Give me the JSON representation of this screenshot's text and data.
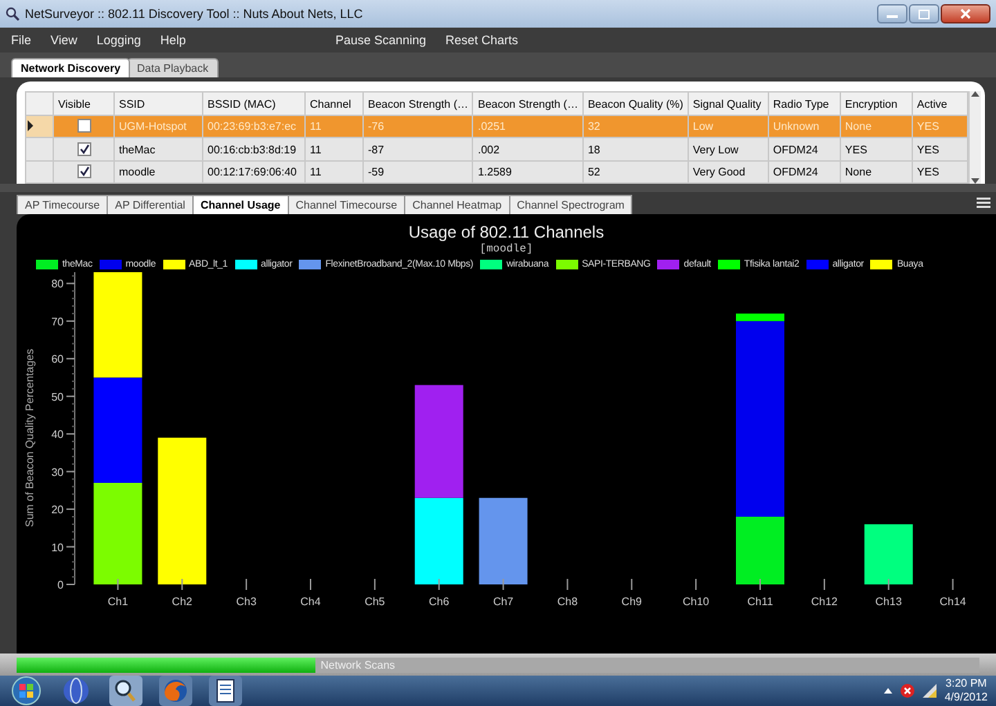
{
  "window": {
    "title": "NetSurveyor :: 802.11 Discovery Tool :: Nuts About Nets, LLC"
  },
  "menu": [
    "File",
    "View",
    "Logging",
    "Help"
  ],
  "toolbar": [
    "Pause Scanning",
    "Reset Charts"
  ],
  "tabs": [
    {
      "label": "Network Discovery",
      "selected": true
    },
    {
      "label": "Data Playback",
      "selected": false
    }
  ],
  "table": {
    "columns": [
      "Visible",
      "SSID",
      "BSSID (MAC)",
      "Channel",
      "Beacon Strength (…",
      "Beacon Strength (…",
      "Beacon Quality (%)",
      "Signal Quality",
      "Radio Type",
      "Encryption",
      "Active"
    ],
    "rows": [
      {
        "selected": true,
        "cells": [
          {
            "kind": "checkbox",
            "checked": false
          },
          {
            "kind": "text",
            "text": "UGM-Hotspot"
          },
          {
            "kind": "text",
            "text": "00:23:69:b3:e7:ec"
          },
          {
            "kind": "text",
            "text": "11"
          },
          {
            "kind": "text",
            "text": "-76"
          },
          {
            "kind": "text",
            "text": ".0251"
          },
          {
            "kind": "text",
            "text": "32"
          },
          {
            "kind": "text",
            "text": "Low"
          },
          {
            "kind": "text",
            "text": "Unknown"
          },
          {
            "kind": "text",
            "text": "None"
          },
          {
            "kind": "text",
            "text": "YES"
          }
        ]
      },
      {
        "selected": false,
        "cells": [
          {
            "kind": "checkbox",
            "checked": true
          },
          {
            "kind": "text",
            "text": "theMac"
          },
          {
            "kind": "text",
            "text": "00:16:cb:b3:8d:19"
          },
          {
            "kind": "text",
            "text": "11"
          },
          {
            "kind": "text",
            "text": "-87"
          },
          {
            "kind": "text",
            "text": ".002"
          },
          {
            "kind": "text",
            "text": "18"
          },
          {
            "kind": "text",
            "text": "Very Low"
          },
          {
            "kind": "text",
            "text": "OFDM24"
          },
          {
            "kind": "text",
            "text": "YES"
          },
          {
            "kind": "text",
            "text": "YES"
          }
        ]
      },
      {
        "selected": false,
        "cells": [
          {
            "kind": "checkbox",
            "checked": true
          },
          {
            "kind": "text",
            "text": "moodle"
          },
          {
            "kind": "text",
            "text": "00:12:17:69:06:40"
          },
          {
            "kind": "text",
            "text": "11"
          },
          {
            "kind": "text",
            "text": "-59"
          },
          {
            "kind": "text",
            "text": "1.2589"
          },
          {
            "kind": "text",
            "text": "52"
          },
          {
            "kind": "text",
            "text": "Very Good"
          },
          {
            "kind": "text",
            "text": "OFDM24"
          },
          {
            "kind": "text",
            "text": "None"
          },
          {
            "kind": "text",
            "text": "YES"
          }
        ]
      }
    ]
  },
  "chart_tabs": [
    {
      "label": "AP Timecourse",
      "selected": false
    },
    {
      "label": "AP Differential",
      "selected": false
    },
    {
      "label": "Channel Usage",
      "selected": true
    },
    {
      "label": "Channel Timecourse",
      "selected": false
    },
    {
      "label": "Channel Heatmap",
      "selected": false
    },
    {
      "label": "Channel Spectrogram",
      "selected": false
    }
  ],
  "chart": {
    "subtitle": "[moodle]",
    "chart_data": {
      "type": "bar",
      "stacked": true,
      "legend": true,
      "title": "Usage of 802.11 Channels",
      "ylabel": "Sum of Beacon Quality Percentages",
      "categories": [
        "Ch1",
        "Ch2",
        "Ch3",
        "Ch4",
        "Ch5",
        "Ch6",
        "Ch7",
        "Ch8",
        "Ch9",
        "Ch10",
        "Ch11",
        "Ch12",
        "Ch13",
        "Ch14"
      ],
      "ylim": [
        0,
        83
      ],
      "yticks": [
        0,
        10,
        20,
        30,
        40,
        50,
        60,
        70,
        80
      ],
      "series": [
        {
          "name": "theMac",
          "color": "#00ee22",
          "values": [
            null,
            null,
            null,
            null,
            null,
            null,
            null,
            null,
            null,
            null,
            18,
            null,
            null,
            null
          ]
        },
        {
          "name": "moodle",
          "color": "#0000ee",
          "values": [
            null,
            null,
            null,
            null,
            null,
            null,
            null,
            null,
            null,
            null,
            52,
            null,
            null,
            null
          ]
        },
        {
          "name": "ABD_lt_1",
          "color": "#ffff00",
          "values": [
            null,
            39,
            null,
            null,
            null,
            null,
            null,
            null,
            null,
            null,
            null,
            null,
            null,
            null
          ]
        },
        {
          "name": "alligator",
          "color": "#00ffff",
          "values": [
            null,
            null,
            null,
            null,
            null,
            23,
            null,
            null,
            null,
            null,
            null,
            null,
            null,
            null
          ]
        },
        {
          "name": "FlexinetBroadband_2(Max.10 Mbps)",
          "color": "#6495ed",
          "values": [
            null,
            null,
            null,
            null,
            null,
            null,
            23,
            null,
            null,
            null,
            null,
            null,
            null,
            null
          ]
        },
        {
          "name": "wirabuana",
          "color": "#00ff7f",
          "values": [
            null,
            null,
            null,
            null,
            null,
            null,
            null,
            null,
            null,
            null,
            null,
            null,
            16,
            null
          ]
        },
        {
          "name": "SAPI-TERBANG",
          "color": "#7cfc00",
          "values": [
            27,
            null,
            null,
            null,
            null,
            null,
            null,
            null,
            null,
            null,
            null,
            null,
            null,
            null
          ]
        },
        {
          "name": "default",
          "color": "#a020f0",
          "values": [
            null,
            null,
            null,
            null,
            null,
            30,
            null,
            null,
            null,
            null,
            null,
            null,
            null,
            null
          ]
        },
        {
          "name": "Tfisika lantai2",
          "color": "#00ff00",
          "values": [
            null,
            null,
            null,
            null,
            null,
            null,
            null,
            null,
            null,
            null,
            2,
            null,
            null,
            null
          ]
        },
        {
          "name": "alligator",
          "color": "#0000ff",
          "values": [
            28,
            null,
            null,
            null,
            null,
            null,
            null,
            null,
            null,
            null,
            null,
            null,
            null,
            null
          ]
        },
        {
          "name": "Buaya",
          "color": "#ffff00",
          "values": [
            28,
            null,
            null,
            null,
            null,
            null,
            null,
            null,
            null,
            null,
            null,
            null,
            null,
            null
          ]
        }
      ]
    }
  },
  "status": {
    "label": "Network Scans",
    "level": 0.31
  },
  "clock": {
    "time": "3:20 PM",
    "date": "4/9/2012"
  }
}
